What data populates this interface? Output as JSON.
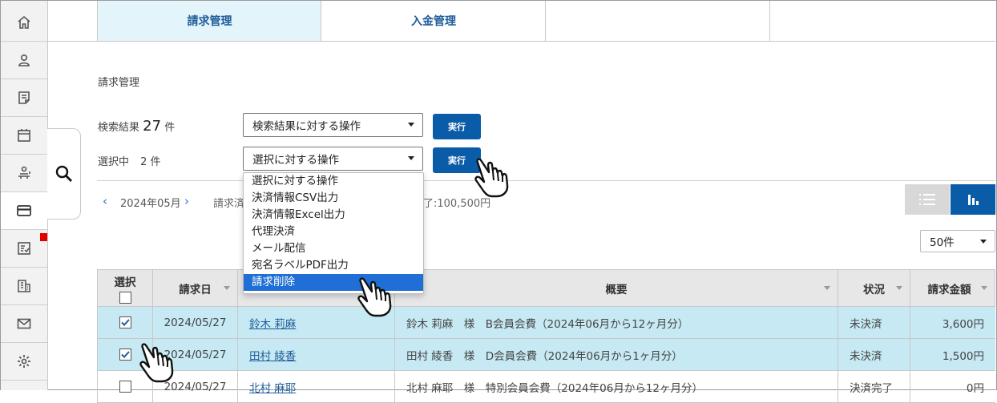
{
  "tabs": [
    "請求管理",
    "入金管理",
    "",
    ""
  ],
  "breadcrumb": "請求管理",
  "search": {
    "results_label": "検索結果",
    "results_count": "27",
    "results_unit": "件",
    "results_select": "検索結果に対する操作",
    "run_label": "実行",
    "selected_label": "選択中",
    "selected_count": "2 件",
    "selected_select": "選択に対する操作"
  },
  "dropdown_options": [
    "選択に対する操作",
    "決済情報CSV出力",
    "決済情報Excel出力",
    "代理決済",
    "メール配信",
    "宛名ラベルPDF出力",
    "請求削除"
  ],
  "dropdown_selected_index": 6,
  "month_nav": {
    "month": "2024年05月",
    "summary_left": "請求済",
    "summary_right": "了:100,500円"
  },
  "per_page": "50件",
  "table": {
    "headers": [
      "選択",
      "請求日",
      "",
      "概要",
      "状況",
      "請求金額"
    ],
    "rows": [
      {
        "checked": true,
        "date": "2024/05/27",
        "name": "鈴木 莉麻",
        "summary": "鈴木 莉麻　様　B会員会費（2024年06月から12ヶ月分）",
        "status": "未決済",
        "amount": "3,600円"
      },
      {
        "checked": true,
        "date": "2024/05/27",
        "name": "田村 綾香",
        "summary": "田村 綾香　様　D会員会費（2024年06月から1ヶ月分）",
        "status": "未決済",
        "amount": "1,500円"
      },
      {
        "checked": false,
        "date": "2024/05/27",
        "name": "北村 麻耶",
        "summary": "北村 麻耶　様　特別会員会費（2024年06月から12ヶ月分）",
        "status": "決済完了",
        "amount": "0円"
      }
    ]
  },
  "colors": {
    "accent": "#0a5ca8",
    "selected_row": "#c6e9f3",
    "tab_active": "#e3f4fb",
    "dropdown_highlight": "#1f6fd6"
  },
  "nav_icons": [
    "home-icon",
    "person-icon",
    "memo-icon",
    "calendar-icon",
    "reception-icon",
    "card-icon",
    "checklist-icon",
    "building-icon",
    "mail-icon",
    "gear-icon"
  ]
}
